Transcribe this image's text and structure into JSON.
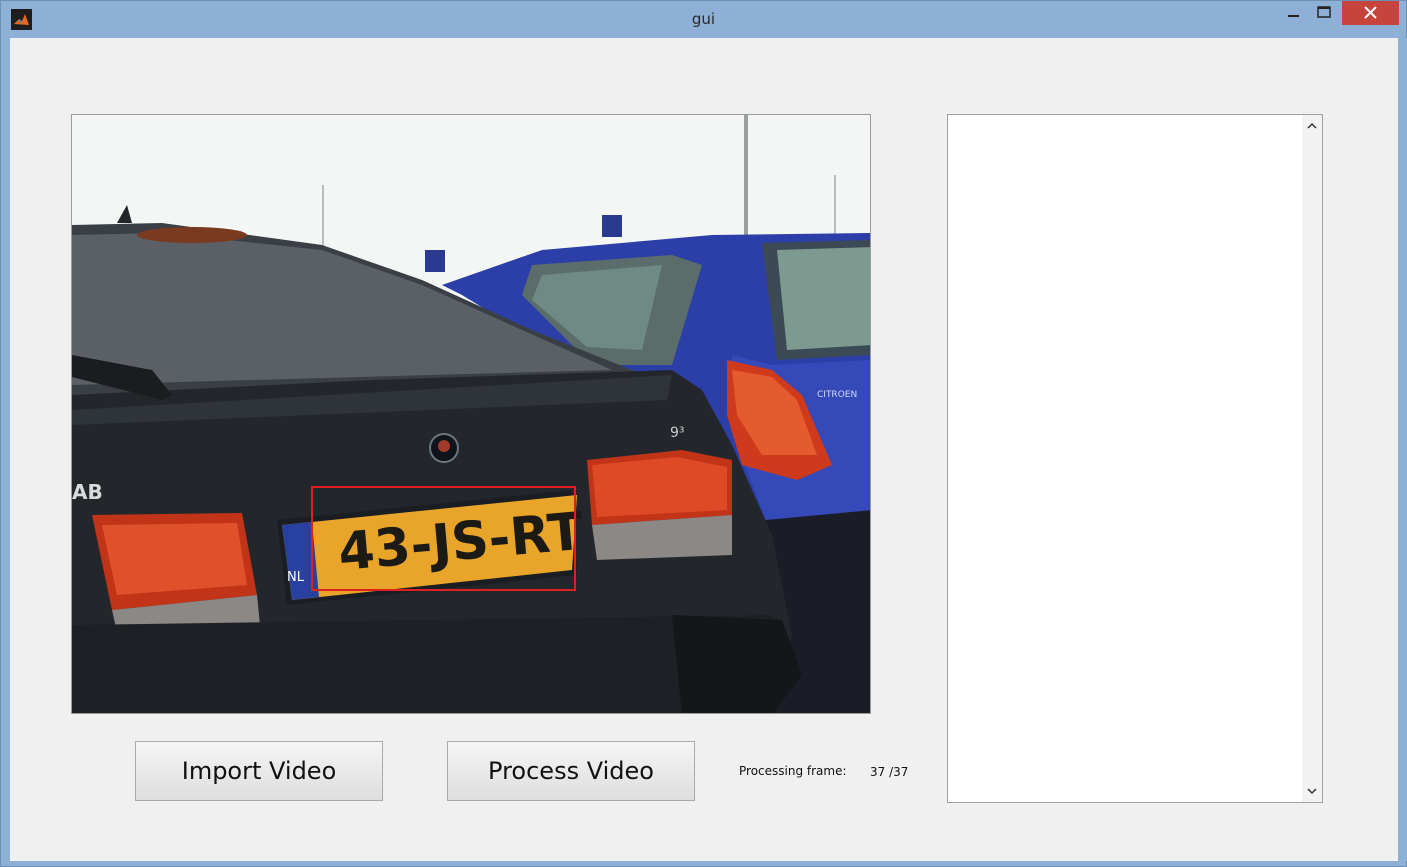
{
  "window": {
    "title": "gui",
    "app_icon": "matlab-icon",
    "controls": [
      "minimize-icon",
      "maximize-icon",
      "close-icon"
    ]
  },
  "buttons": {
    "import_label": "Import Video",
    "process_label": "Process Video"
  },
  "status": {
    "label": "Processing frame:",
    "value": "37 /37"
  },
  "image": {
    "plate_text": "43-JS-RT",
    "plate_country": "NL",
    "badge_text": "AB",
    "model_text": "9³",
    "side_brand_text": "CITROEN",
    "detection_box_color": "#e02020"
  },
  "listbox": {
    "items": [],
    "scroll_up_icon": "chevron-up-icon",
    "scroll_down_icon": "chevron-down-icon"
  }
}
